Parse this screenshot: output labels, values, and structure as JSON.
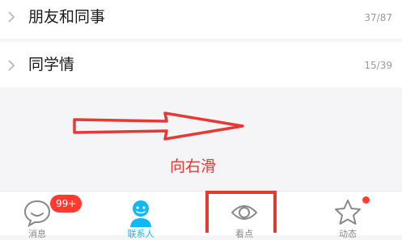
{
  "groups": [
    {
      "name": "朋友和同事",
      "count": "37/87"
    },
    {
      "name": "同学情",
      "count": "15/39"
    }
  ],
  "swipe_hint": "向右滑",
  "tabs": [
    {
      "label": "消息",
      "badge": "99+"
    },
    {
      "label": "联系人"
    },
    {
      "label": "看点"
    },
    {
      "label": "动态"
    }
  ],
  "colors": {
    "accent_blue": "#12b7f5",
    "annotation_red": "#e53935",
    "badge_red": "#ff3b30"
  },
  "icons": {
    "chevron": "chevron-right-icon",
    "messages": "chat-bubble-icon",
    "contacts": "person-icon",
    "watch": "eye-icon",
    "dynamic": "star-icon"
  }
}
